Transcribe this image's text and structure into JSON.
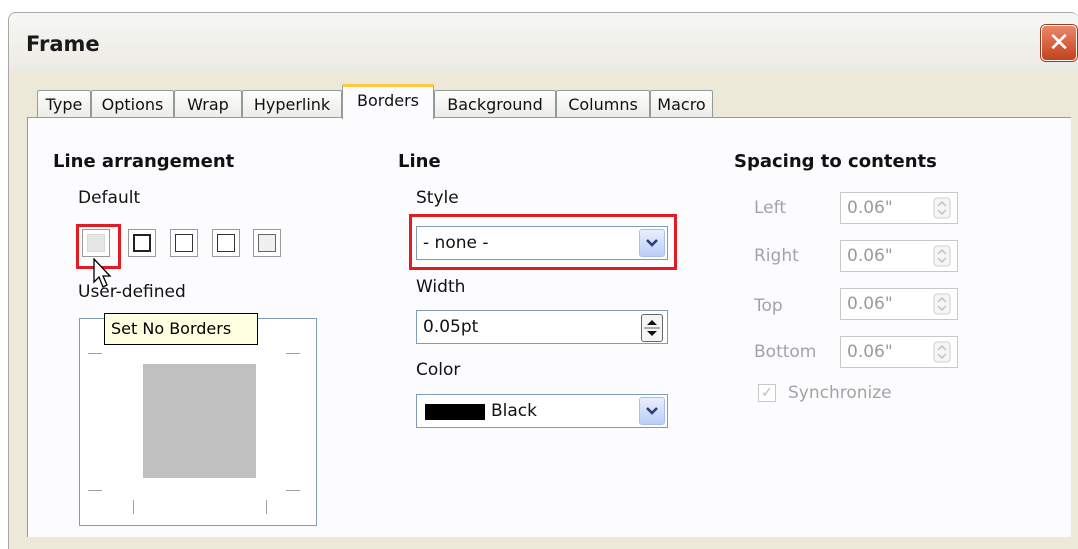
{
  "window": {
    "title": "Frame"
  },
  "tabs": [
    {
      "label": "Type"
    },
    {
      "label": "Options"
    },
    {
      "label": "Wrap"
    },
    {
      "label": "Hyperlink"
    },
    {
      "label": "Borders",
      "active": true
    },
    {
      "label": "Background"
    },
    {
      "label": "Columns"
    },
    {
      "label": "Macro"
    }
  ],
  "line_arrangement": {
    "heading": "Line arrangement",
    "default_label": "Default",
    "user_defined_label": "User-defined",
    "tooltip": "Set No Borders"
  },
  "line": {
    "heading": "Line",
    "style_label": "Style",
    "style_value": "- none -",
    "width_label": "Width",
    "width_value": "0.05pt",
    "color_label": "Color",
    "color_value": "Black",
    "color_swatch": "#000000"
  },
  "spacing": {
    "heading": "Spacing to contents",
    "left_label": "Left",
    "left_value": "0.06\"",
    "right_label": "Right",
    "right_value": "0.06\"",
    "top_label": "Top",
    "top_value": "0.06\"",
    "bottom_label": "Bottom",
    "bottom_value": "0.06\"",
    "synchronize_label": "Synchronize",
    "synchronize_checked": true
  },
  "colors": {
    "highlight": "#e31b23",
    "tab_accent": "#ffc83c"
  }
}
